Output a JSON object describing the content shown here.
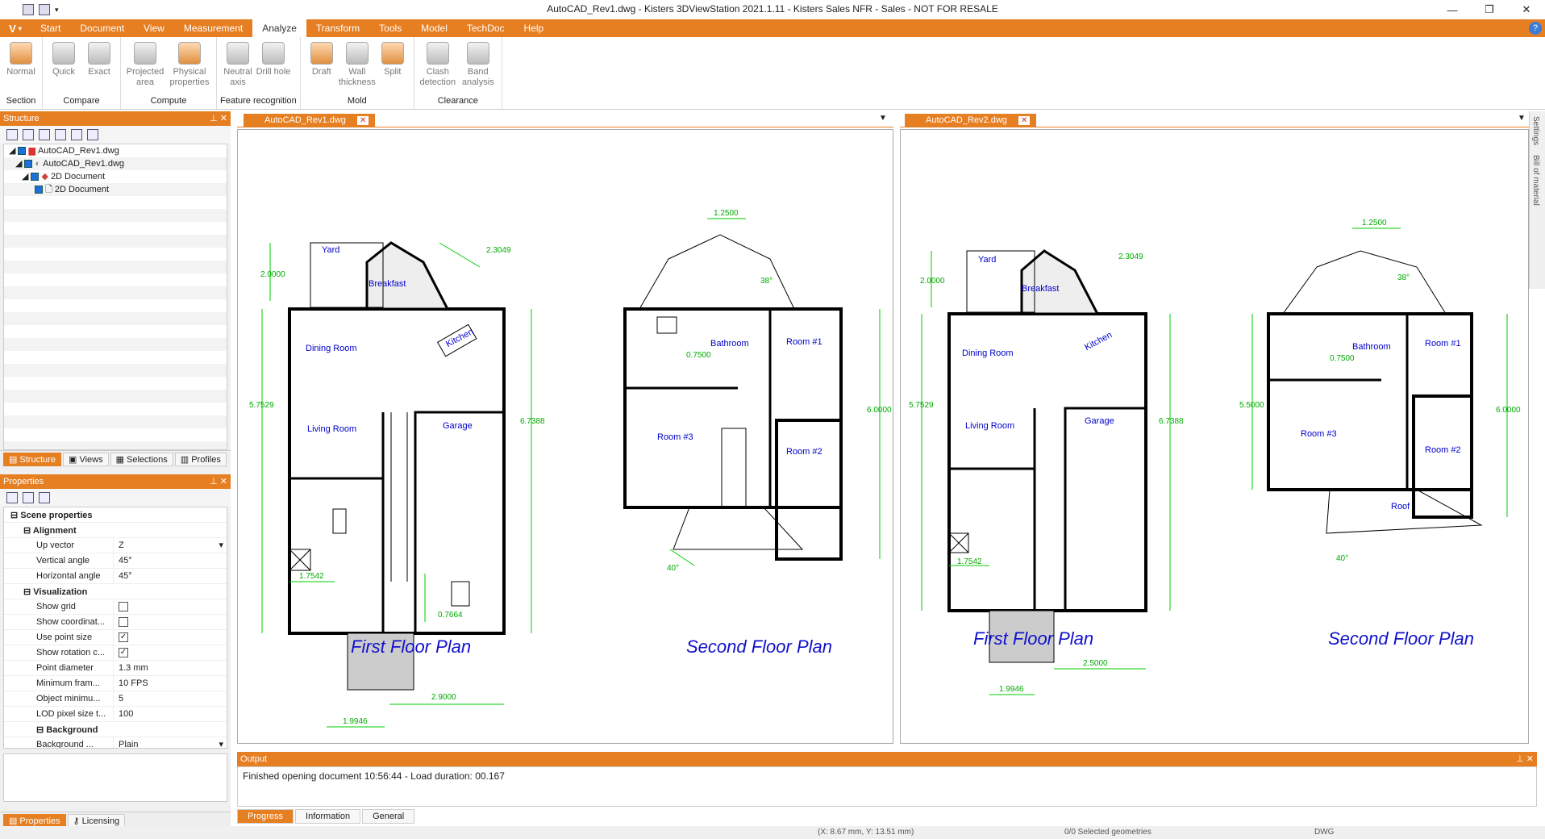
{
  "window": {
    "title": "AutoCAD_Rev1.dwg - Kisters 3DViewStation 2021.1.11 - Kisters Sales NFR - Sales - NOT FOR RESALE"
  },
  "menu": {
    "logo": "V",
    "items": [
      "Start",
      "Document",
      "View",
      "Measurement",
      "Analyze",
      "Transform",
      "Tools",
      "Model",
      "TechDoc",
      "Help"
    ],
    "active": "Analyze"
  },
  "ribbon": {
    "groups": [
      {
        "label": "Section",
        "buttons": [
          "Normal"
        ]
      },
      {
        "label": "Compare",
        "buttons": [
          "Quick",
          "Exact"
        ]
      },
      {
        "label": "Compute",
        "buttons": [
          "Projected area",
          "Physical properties"
        ]
      },
      {
        "label": "Feature recognition",
        "buttons": [
          "Neutral axis",
          "Drill hole"
        ]
      },
      {
        "label": "Mold",
        "buttons": [
          "Draft",
          "Wall thickness",
          "Split"
        ]
      },
      {
        "label": "Clearance",
        "buttons": [
          "Clash detection",
          "Band analysis"
        ]
      }
    ]
  },
  "structure": {
    "title": "Structure",
    "tree": [
      "AutoCAD_Rev1.dwg",
      "AutoCAD_Rev1.dwg",
      "2D Document",
      "2D Document"
    ],
    "tabs": [
      "Structure",
      "Views",
      "Selections",
      "Profiles"
    ]
  },
  "properties": {
    "title": "Properties",
    "scene": "Scene properties",
    "alignment": "Alignment",
    "visualization": "Visualization",
    "background": "Background",
    "rows": [
      {
        "k": "Up vector",
        "v": "Z"
      },
      {
        "k": "Vertical angle",
        "v": "45°"
      },
      {
        "k": "Horizontal angle",
        "v": "45°"
      }
    ],
    "vis": [
      {
        "k": "Show grid",
        "v": ""
      },
      {
        "k": "Show coordinat...",
        "v": ""
      },
      {
        "k": "Use point size",
        "v": "✓"
      },
      {
        "k": "Show rotation c...",
        "v": "✓"
      },
      {
        "k": "Point diameter",
        "v": "1.3 mm"
      },
      {
        "k": "Minimum fram...",
        "v": "10 FPS"
      },
      {
        "k": "Object minimu...",
        "v": "5"
      },
      {
        "k": "LOD pixel size t...",
        "v": "100"
      }
    ],
    "bg": {
      "k": "Background ...",
      "v": "Plain"
    },
    "tabs": [
      "Properties",
      "Licensing"
    ]
  },
  "docs": [
    {
      "tab": "AutoCAD_Rev1.dwg",
      "first": "First Floor Plan",
      "second": "Second Floor Plan"
    },
    {
      "tab": "AutoCAD_Rev2.dwg",
      "first": "First Floor Plan",
      "second": "Second Floor Plan"
    }
  ],
  "plan": {
    "yard": "Yard",
    "breakfast": "Breakfast",
    "kitchen": "Kitchen",
    "dining": "Dining Room",
    "living": "Living Room",
    "garage": "Garage",
    "bathroom": "Bathroom",
    "room1": "Room #1",
    "room2": "Room #2",
    "room3": "Room #3",
    "roof": "Roof",
    "d_20000": "2.0000",
    "d_23049": "2.3049",
    "d_57529": "5.7529",
    "d_67388": "6.7388",
    "d_17542": "1.7542",
    "d_07664": "0.7664",
    "d_29000": "2.9000",
    "d_19946": "1.9946",
    "d_12500": "1.2500",
    "d_38": "38°",
    "d_07500": "0.7500",
    "d_60000": "6.0000",
    "d_40": "40°",
    "d_25000": "2.5000",
    "d_55000": "5.5000"
  },
  "output": {
    "title": "Output",
    "text": "Finished opening document 10:56:44 - Load duration: 00.167",
    "tabs": [
      "Progress",
      "Information",
      "General"
    ]
  },
  "status": {
    "coords": "(X: 8.67 mm, Y: 13.51 mm)",
    "selected": "0/0 Selected geometries",
    "format": "DWG"
  },
  "sidebar": [
    "Settings",
    "Bill of material"
  ]
}
